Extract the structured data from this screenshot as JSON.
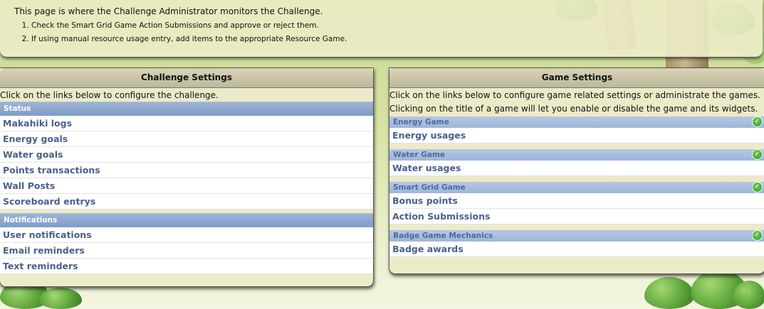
{
  "info": {
    "intro": "This page is where the Challenge Administrator monitors the Challenge.",
    "steps": [
      "Check the Smart Grid Game Action Submissions and approve or reject them.",
      "If using manual resource usage entry, add items to the appropriate Resource Game."
    ]
  },
  "challenge": {
    "title": "Challenge Settings",
    "description": "Click on the links below to configure the challenge.",
    "sections": [
      {
        "label": "Status",
        "links": [
          "Makahiki logs",
          "Energy goals",
          "Water goals",
          "Points transactions",
          "Wall Posts",
          "Scoreboard entrys"
        ]
      },
      {
        "label": "Notifications",
        "links": [
          "User notifications",
          "Email reminders",
          "Text reminders"
        ]
      }
    ]
  },
  "game": {
    "title": "Game Settings",
    "description_1": "Click on the links below to configure game related settings or administrate the games.",
    "description_2": "Clicking on the title of a game will let you enable or disable the game and its widgets.",
    "games": [
      {
        "label": "Energy Game",
        "enabled": true,
        "links": [
          "Energy usages"
        ]
      },
      {
        "label": "Water Game",
        "enabled": true,
        "links": [
          "Water usages"
        ]
      },
      {
        "label": "Smart Grid Game",
        "enabled": true,
        "links": [
          "Bonus points",
          "Action Submissions"
        ]
      },
      {
        "label": "Badge Game Mechanics",
        "enabled": true,
        "links": [
          "Badge awards"
        ]
      }
    ],
    "enabled_icon": "check-circle-icon"
  },
  "colors": {
    "link": "#4a5f8d",
    "section_header": "#8fa9d0",
    "enabled": "#2d9a2a"
  }
}
